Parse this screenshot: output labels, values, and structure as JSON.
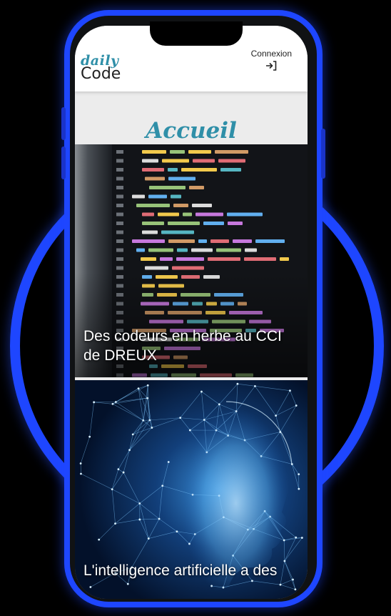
{
  "app": {
    "logo_top": "daily",
    "logo_bottom": "Code"
  },
  "header": {
    "login_label": "Connexion",
    "login_icon": "login-arrow-icon"
  },
  "page": {
    "title": "Accueil"
  },
  "articles": [
    {
      "title": "Des codeurs en herbe au CCI de DREUX",
      "image": "code-editor-screenshot"
    },
    {
      "title": "L'intelligence artificielle a des",
      "image": "ai-network-face"
    }
  ],
  "colors": {
    "accent": "#2f8fa8",
    "frame_blue": "#1e46ff",
    "background": "#000000"
  }
}
